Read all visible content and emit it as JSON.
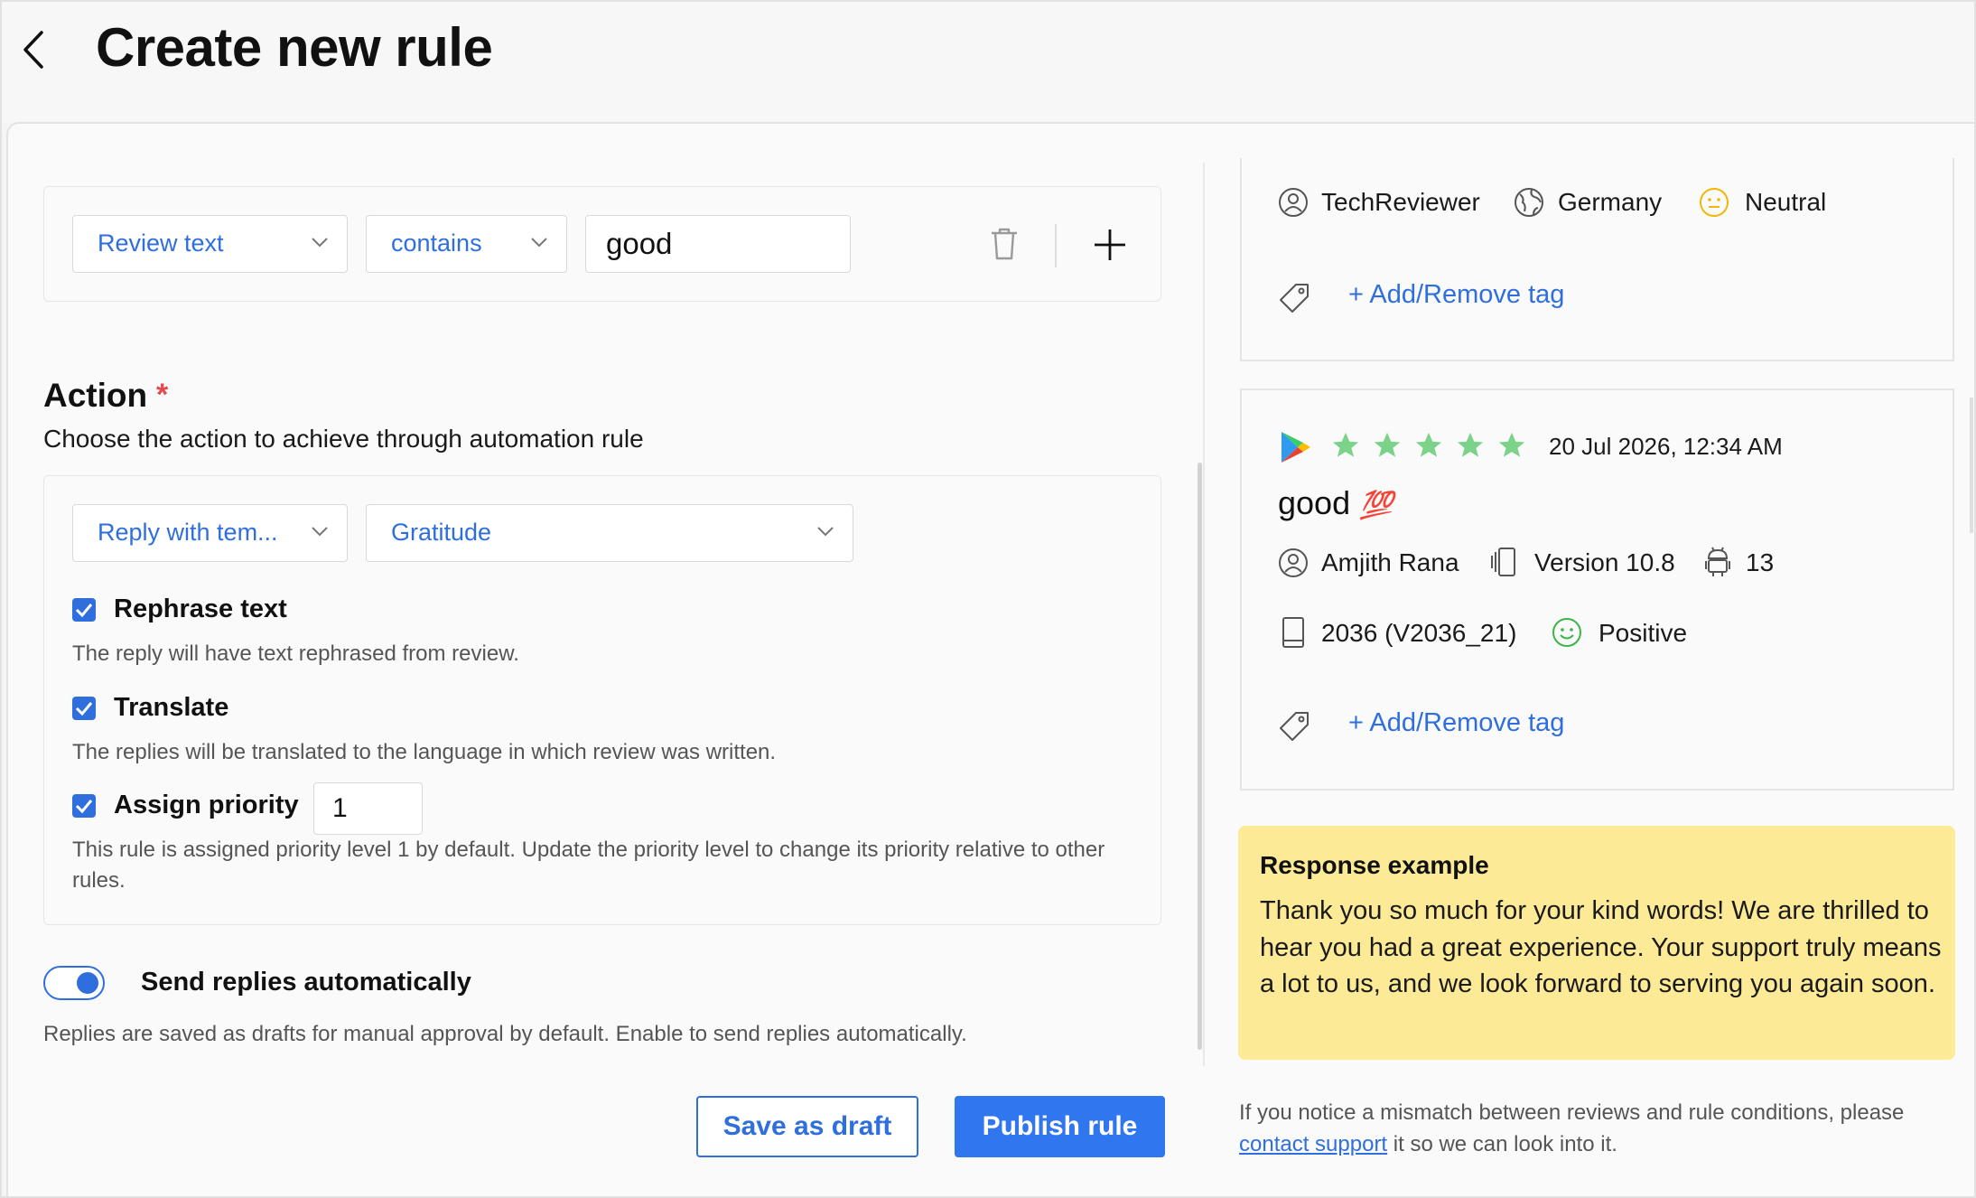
{
  "header": {
    "title": "Create new rule"
  },
  "condition": {
    "field": "Review text",
    "operator": "contains",
    "value": "good"
  },
  "action": {
    "title": "Action",
    "required_mark": "*",
    "subtitle": "Choose the action to achieve through automation rule",
    "action_type": "Reply with tem...",
    "template": "Gratitude",
    "options": {
      "rephrase": {
        "label": "Rephrase text",
        "desc": "The reply will have text rephrased from review.",
        "checked": true
      },
      "translate": {
        "label": "Translate",
        "desc": "The replies will be translated to the language in which review was written.",
        "checked": true
      },
      "priority": {
        "label": "Assign priority",
        "value": "1",
        "desc": "This rule is assigned priority level 1 by default. Update the priority level to change its priority relative to other rules.",
        "checked": true
      }
    }
  },
  "auto_send": {
    "label": "Send replies automatically",
    "desc": "Replies are saved as drafts for manual approval by default. Enable to send replies automatically.",
    "enabled": true
  },
  "buttons": {
    "save_draft": "Save as draft",
    "publish": "Publish rule"
  },
  "review_cards": [
    {
      "user": "TechReviewer",
      "country": "Germany",
      "sentiment": "Neutral",
      "tag_link": "+ Add/Remove tag"
    },
    {
      "rating": 5,
      "date": "20 Jul 2026, 12:34 AM",
      "title": "good",
      "emoji": "💯",
      "user": "Amjith Rana",
      "version": "Version 10.8",
      "os": "13",
      "device": "2036 (V2036_21)",
      "sentiment": "Positive",
      "tag_link": "+ Add/Remove tag"
    }
  ],
  "response": {
    "title": "Response example",
    "text": "Thank you so much for your kind words! We are thrilled to hear you had a great experience. Your support truly means a lot to us, and we look forward to serving you again soon."
  },
  "footnote": {
    "before": "If you notice a mismatch between reviews and rule conditions, please ",
    "link": "contact support",
    "after": " it so we can look into it."
  },
  "colors": {
    "accent": "#2f6fdd",
    "primary_button": "#2f76ef",
    "star": "#7bd389",
    "neutral_face": "#f2b705",
    "positive_face": "#3bb54a",
    "response_bg": "#fcea97",
    "required": "#e5484d"
  }
}
